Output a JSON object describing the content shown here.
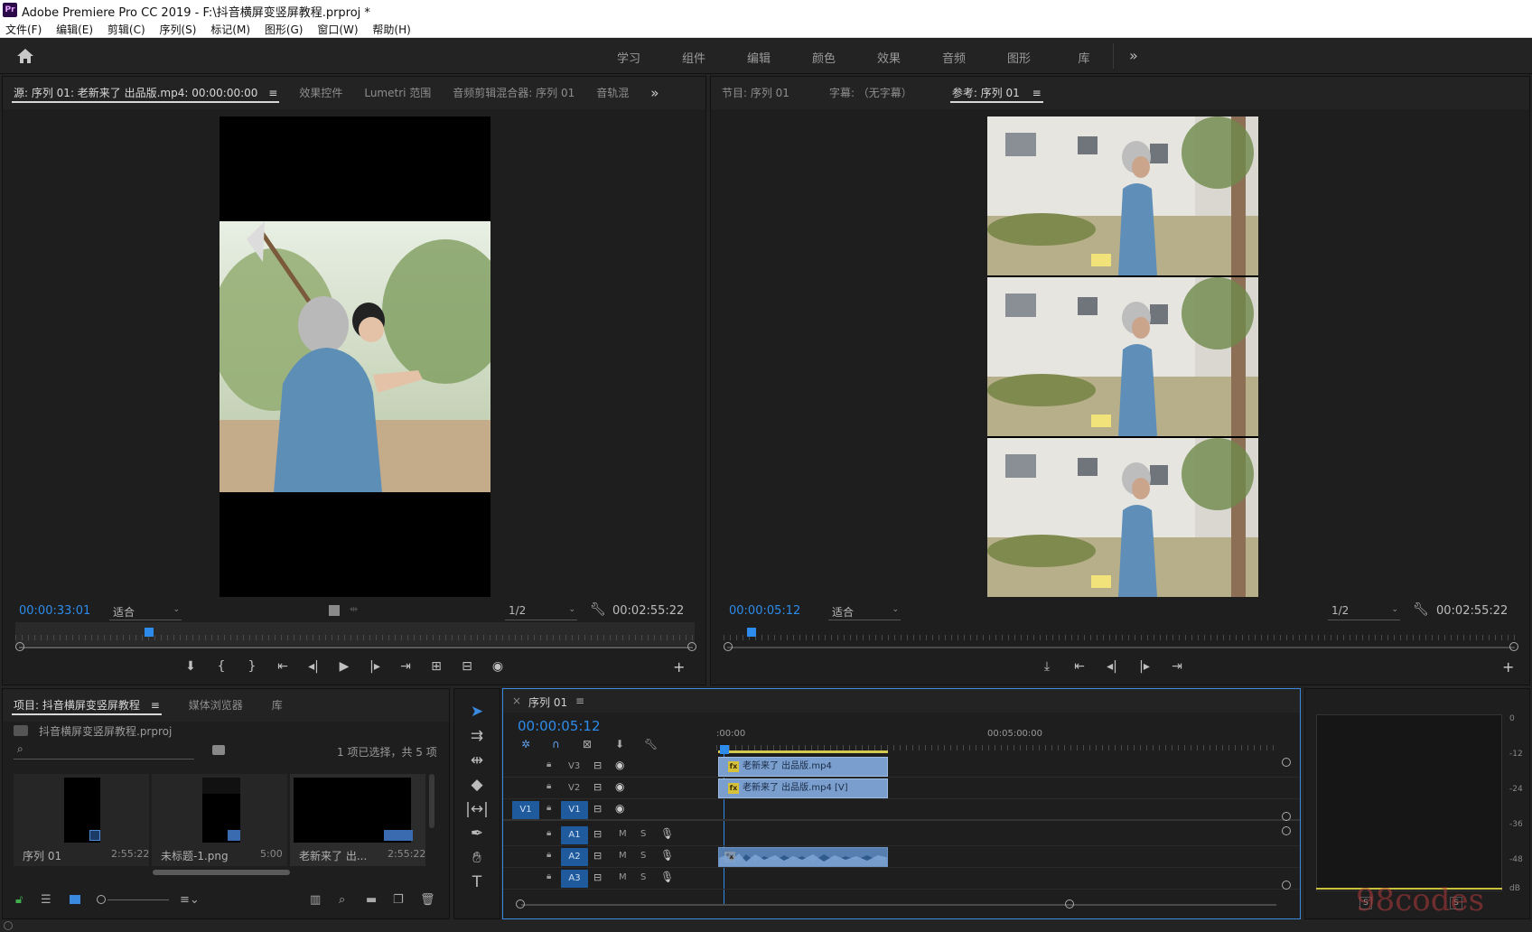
{
  "app": {
    "title": "Adobe Premiere Pro CC 2019 - F:\\抖音横屏变竖屏教程.prproj *",
    "icon_text": "Pr"
  },
  "menu": [
    "文件(F)",
    "编辑(E)",
    "剪辑(C)",
    "序列(S)",
    "标记(M)",
    "图形(G)",
    "窗口(W)",
    "帮助(H)"
  ],
  "workspaces": {
    "tabs": [
      "学习",
      "组件",
      "编辑",
      "颜色",
      "效果",
      "音频",
      "图形",
      "库"
    ],
    "more": "»"
  },
  "source_panel": {
    "tabs": [
      "源: 序列 01: 老新来了 出品版.mp4: 00:00:00:00",
      "效果控件",
      "Lumetri 范围",
      "音频剪辑混合器: 序列 01",
      "音轨混"
    ],
    "menu_icon": "≡",
    "more": "»",
    "timecode": "00:00:33:01",
    "fit": "适合",
    "resolution": "1/2",
    "duration": "00:02:55:22",
    "playhead_fraction": 0.19
  },
  "program_panel": {
    "tabs": [
      "节目: 序列 01",
      "字幕: （无字幕）",
      "参考: 序列 01"
    ],
    "menu_icon": "≡",
    "timecode": "00:00:05:12",
    "fit": "适合",
    "resolution": "1/2",
    "duration": "00:02:55:22",
    "playhead_fraction": 0.03
  },
  "project_panel": {
    "tabs": [
      "项目: 抖音横屏变竖屏教程",
      "媒体浏览器",
      "库"
    ],
    "menu_icon": "≡",
    "project_file": "抖音横屏变竖屏教程.prproj",
    "search_placeholder": "",
    "selection_info": "1 项已选择，共 5 项",
    "items": [
      {
        "name": "序列 01",
        "duration": "2:55:22"
      },
      {
        "name": "未标题-1.png",
        "duration": "5:00"
      },
      {
        "name": "老新来了 出...",
        "duration": "2:55:22"
      }
    ]
  },
  "timeline": {
    "close": "×",
    "title": "序列 01",
    "menu_icon": "≡",
    "timecode": "00:00:05:12",
    "ruler_labels": [
      ":00:00",
      "00:05:00:00"
    ],
    "video_tracks": [
      {
        "target": "",
        "name": "V3",
        "clip": "老新来了 出品版.mp4"
      },
      {
        "target": "",
        "name": "V2",
        "clip": "老新来了 出品版.mp4 [V]"
      },
      {
        "target": "V1",
        "name": "V1",
        "clip": ""
      }
    ],
    "audio_tracks": [
      {
        "name": "A1",
        "m": "M",
        "s": "S"
      },
      {
        "name": "A2",
        "m": "M",
        "s": "S"
      },
      {
        "name": "A3",
        "m": "M",
        "s": "S"
      }
    ],
    "fx_badge": "fx"
  },
  "meter": {
    "scale": [
      "0",
      "-12",
      "-24",
      "-36",
      "-48",
      "dB"
    ],
    "solo": [
      "S",
      "S"
    ]
  },
  "watermark": "98codes",
  "colors": {
    "accent_blue": "#2d8ceb",
    "clip_blue": "#7a9fcf",
    "panel_bg": "#1e1e1e",
    "frame_bg": "#232323"
  }
}
